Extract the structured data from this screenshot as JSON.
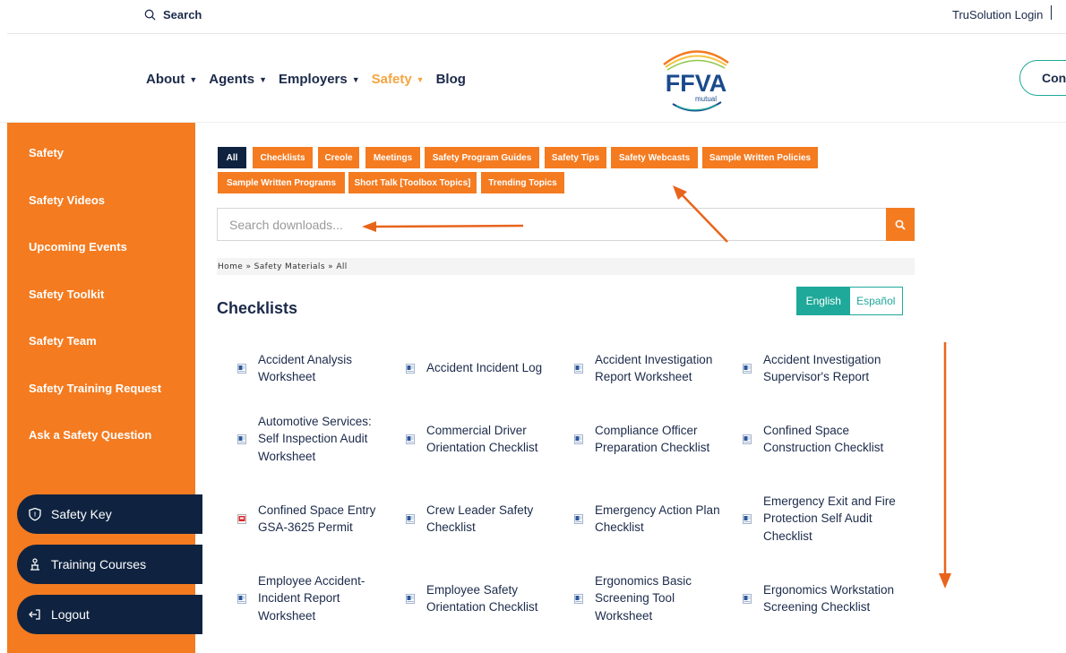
{
  "topbar": {
    "search_label": "Search",
    "login_label": "TruSolution Login"
  },
  "nav": {
    "items": [
      {
        "label": "About",
        "caret": "▼",
        "active": false
      },
      {
        "label": "Agents",
        "caret": "▼",
        "active": false
      },
      {
        "label": "Employers",
        "caret": "▼",
        "active": false
      },
      {
        "label": "Safety",
        "caret": "▼",
        "active": true
      },
      {
        "label": "Blog",
        "caret": "",
        "active": false
      }
    ],
    "logo": {
      "main": "FFVA",
      "sub": "mutual"
    },
    "contact_label": "Cont"
  },
  "sidebar": {
    "links": [
      "Safety",
      "Safety Videos",
      "Upcoming Events",
      "Safety Toolkit",
      "Safety Team",
      "Safety Training Request",
      "Ask a Safety Question"
    ],
    "buttons": [
      {
        "label": "Safety Key",
        "icon": "shield-icon"
      },
      {
        "label": "Training Courses",
        "icon": "training-icon"
      },
      {
        "label": "Logout",
        "icon": "logout-icon"
      }
    ]
  },
  "tabs": [
    "All",
    "Checklists",
    "Creole",
    "Meetings",
    "Safety Program Guides",
    "Safety Tips",
    "Safety Webcasts",
    "Sample Written Policies",
    "Sample Written Programs",
    "Short Talk [Toolbox Topics]",
    "Trending Topics"
  ],
  "search": {
    "placeholder": "Search downloads..."
  },
  "breadcrumb": "Home » Safety Materials » All",
  "section": {
    "title": "Checklists",
    "lang_english": "English",
    "lang_spanish": "Español"
  },
  "documents": [
    {
      "title": "Accident Analysis Worksheet",
      "type": "doc"
    },
    {
      "title": "Accident Incident Log",
      "type": "doc"
    },
    {
      "title": "Accident Investigation Report Worksheet",
      "type": "doc"
    },
    {
      "title": "Accident Investigation Supervisor's Report",
      "type": "doc"
    },
    {
      "title": "Automotive Services: Self Inspection Audit Worksheet",
      "type": "doc"
    },
    {
      "title": "Commercial Driver Orientation Checklist",
      "type": "doc"
    },
    {
      "title": "Compliance Officer Preparation Checklist",
      "type": "doc"
    },
    {
      "title": "Confined Space Construction Checklist",
      "type": "doc"
    },
    {
      "title": "Confined Space Entry GSA-3625 Permit",
      "type": "pdf"
    },
    {
      "title": "Crew Leader Safety Checklist",
      "type": "doc"
    },
    {
      "title": "Emergency Action Plan Checklist",
      "type": "doc"
    },
    {
      "title": "Emergency Exit and Fire Protection Self Audit Checklist",
      "type": "doc"
    },
    {
      "title": "Employee Accident-Incident Report Worksheet",
      "type": "doc"
    },
    {
      "title": "Employee Safety Orientation Checklist",
      "type": "doc"
    },
    {
      "title": "Ergonomics Basic Screening Tool Worksheet",
      "type": "doc"
    },
    {
      "title": "Ergonomics Workstation Screening Checklist",
      "type": "doc"
    }
  ],
  "colors": {
    "orange": "#f47b20",
    "navy": "#0f2340",
    "teal": "#1fa99a",
    "safety_active": "#f5a53f"
  }
}
